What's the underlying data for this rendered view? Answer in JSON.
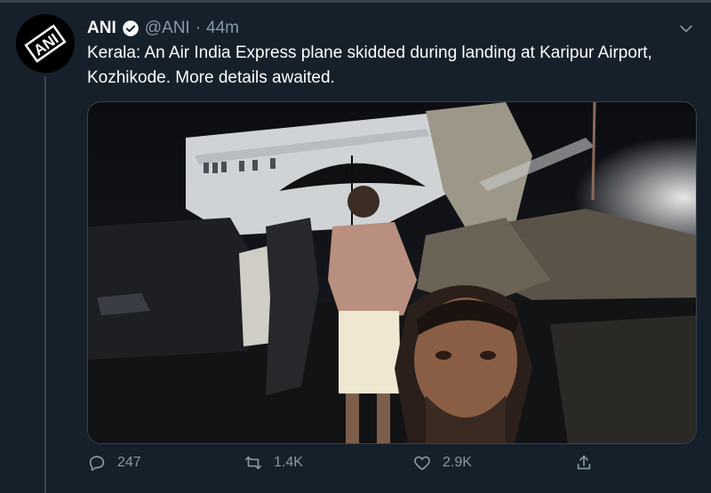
{
  "tweet": {
    "author_name": "ANI",
    "handle": "@ANI",
    "separator": "·",
    "time": "44m",
    "text": "Kerala: An Air India Express plane skidded during landing at Karipur Airport, Kozhikode. More details awaited.",
    "avatar_text": "ANI"
  },
  "actions": {
    "replies": "247",
    "retweets": "1.4K",
    "likes": "2.9K"
  },
  "colors": {
    "background": "#15202b",
    "secondary_text": "#8899a6",
    "border": "#38444d"
  },
  "icons": [
    "verified-badge-icon",
    "chevron-down-icon",
    "reply-icon",
    "retweet-icon",
    "like-icon",
    "share-icon"
  ]
}
